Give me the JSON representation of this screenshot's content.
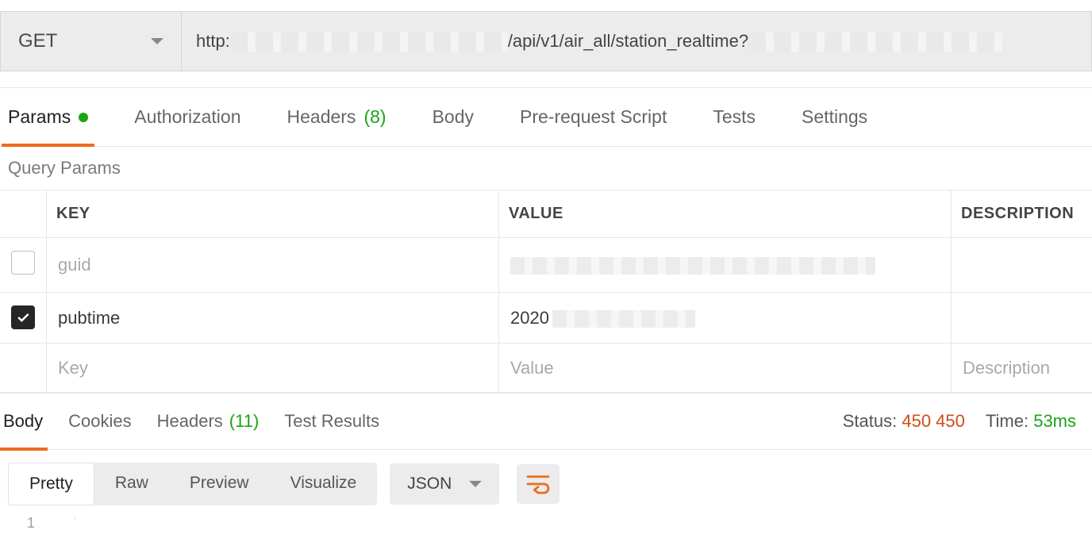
{
  "request": {
    "method": "GET",
    "url_prefix": "http:",
    "url_path": "/api/v1/air_all/station_realtime?"
  },
  "request_tabs": {
    "params": "Params",
    "authorization": "Authorization",
    "headers_label": "Headers",
    "headers_count": "(8)",
    "body": "Body",
    "prerequest": "Pre-request Script",
    "tests": "Tests",
    "settings": "Settings"
  },
  "section_label": "Query Params",
  "param_headers": {
    "key": "KEY",
    "value": "VALUE",
    "description": "DESCRIPTION"
  },
  "param_rows": [
    {
      "checked": false,
      "key": "guid",
      "value": ""
    },
    {
      "checked": true,
      "key": "pubtime",
      "value": "2020"
    }
  ],
  "param_placeholders": {
    "key": "Key",
    "value": "Value",
    "description": "Description"
  },
  "response_tabs": {
    "body": "Body",
    "cookies": "Cookies",
    "headers_label": "Headers",
    "headers_count": "(11)",
    "test_results": "Test Results"
  },
  "response_meta": {
    "status_label": "Status:",
    "status_value": "450 450",
    "time_label": "Time:",
    "time_value": "53ms"
  },
  "format_tabs": {
    "pretty": "Pretty",
    "raw": "Raw",
    "preview": "Preview",
    "visualize": "Visualize"
  },
  "lang_select": "JSON",
  "json_first_line_no": "1"
}
